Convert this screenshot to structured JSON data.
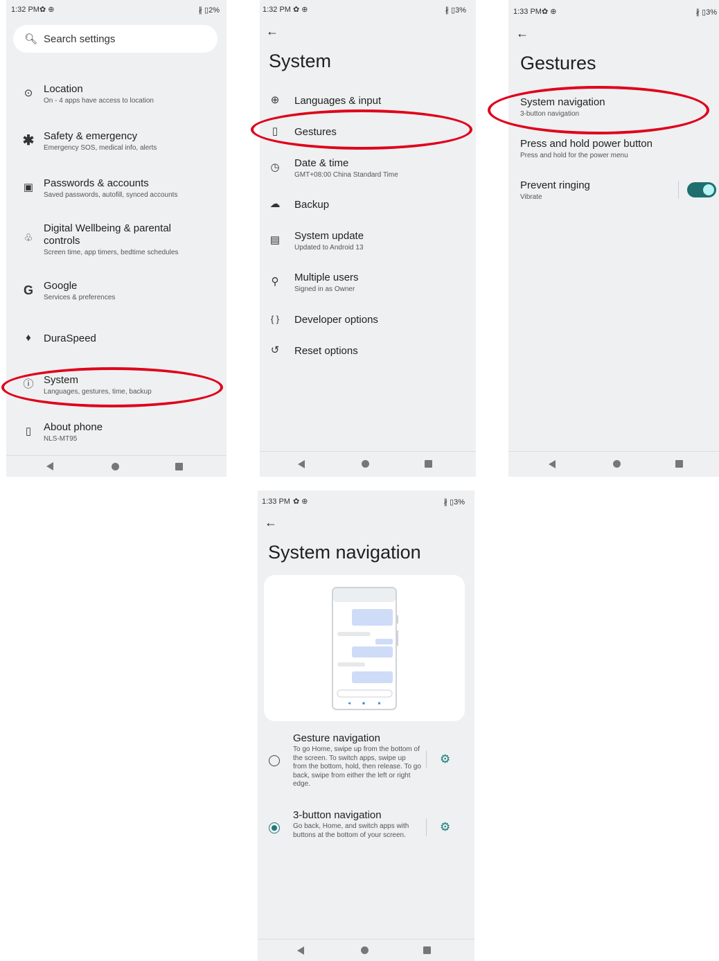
{
  "colors": {
    "highlight": "#e0001b",
    "accent": "#1e7a7a",
    "background": "#eef0f1"
  },
  "screen1": {
    "status": {
      "time": "1:32 PM",
      "battery": "2%"
    },
    "search_placeholder": "Search settings",
    "items": [
      {
        "icon": "location-pin-icon",
        "title": "Location",
        "subtitle": "On - 4 apps have access to location"
      },
      {
        "icon": "asterisk-icon",
        "title": "Safety & emergency",
        "subtitle": "Emergency SOS, medical info, alerts"
      },
      {
        "icon": "account-box-icon",
        "title": "Passwords & accounts",
        "subtitle": "Saved passwords, autofill, synced accounts"
      },
      {
        "icon": "wellbeing-icon",
        "title": "Digital Wellbeing & parental",
        "title2": "controls",
        "subtitle": "Screen time, app timers, bedtime schedules"
      },
      {
        "icon": "google-icon",
        "title": "Google",
        "subtitle": "Services & preferences"
      },
      {
        "icon": "duraspeed-icon",
        "title": "DuraSpeed",
        "subtitle": ""
      },
      {
        "icon": "info-icon",
        "title": "System",
        "subtitle": "Languages, gestures, time, backup"
      },
      {
        "icon": "phone-icon",
        "title": "About phone",
        "subtitle": "NLS-MT95"
      }
    ]
  },
  "screen2": {
    "status": {
      "time": "1:32 PM",
      "battery": "3%"
    },
    "title": "System",
    "items": [
      {
        "icon": "globe-icon",
        "title": "Languages & input",
        "subtitle": ""
      },
      {
        "icon": "gestures-icon",
        "title": "Gestures",
        "subtitle": ""
      },
      {
        "icon": "clock-icon",
        "title": "Date & time",
        "subtitle": "GMT+08:00 China Standard Time"
      },
      {
        "icon": "cloud-upload-icon",
        "title": "Backup",
        "subtitle": ""
      },
      {
        "icon": "system-update-icon",
        "title": "System update",
        "subtitle": "Updated to Android 13"
      },
      {
        "icon": "person-icon",
        "title": "Multiple users",
        "subtitle": "Signed in as Owner"
      },
      {
        "icon": "braces-icon",
        "title": "Developer options",
        "subtitle": ""
      },
      {
        "icon": "history-icon",
        "title": "Reset options",
        "subtitle": ""
      }
    ]
  },
  "screen3": {
    "status": {
      "time": "1:33 PM",
      "battery": "3%"
    },
    "title": "Gestures",
    "items": [
      {
        "title": "System navigation",
        "subtitle": "3-button navigation"
      },
      {
        "title": "Press and hold power button",
        "subtitle": "Press and hold for the power menu"
      },
      {
        "title": "Prevent ringing",
        "subtitle": "Vibrate",
        "toggle_on": true
      }
    ]
  },
  "screen4": {
    "status": {
      "time": "1:33 PM",
      "battery": "3%"
    },
    "title": "System navigation",
    "options": [
      {
        "title": "Gesture navigation",
        "description": "To go Home, swipe up from the bottom of the screen. To switch apps, swipe up from the bottom, hold, then release. To go back, swipe from either the left or right edge.",
        "selected": false
      },
      {
        "title": "3-button navigation",
        "description": "Go back, Home, and switch apps with buttons at the bottom of your screen.",
        "selected": true
      }
    ]
  }
}
